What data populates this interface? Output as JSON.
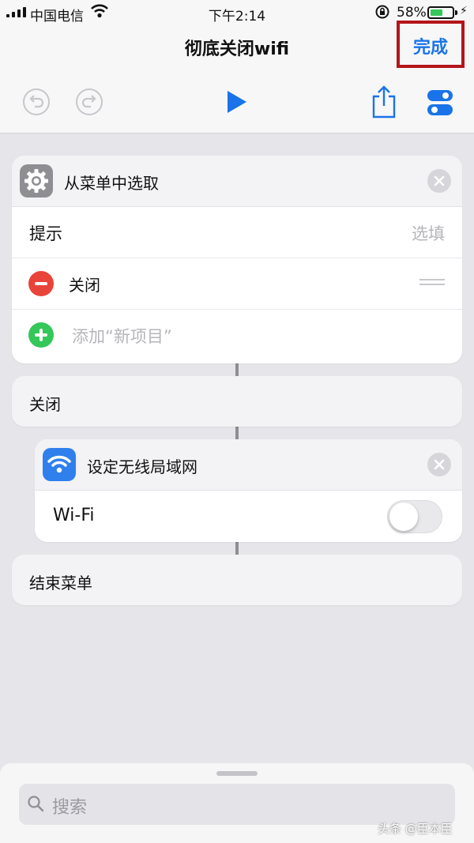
{
  "status_bar": {
    "carrier": "中国电信",
    "time": "下午2:14",
    "battery_percent": "58%",
    "battery_level": 0.58
  },
  "nav": {
    "title": "彻底关闭wifi",
    "done_label": "完成"
  },
  "toolbar": {
    "icons": [
      "undo-icon",
      "redo-icon",
      "play-icon",
      "share-icon",
      "settings-toggle-icon"
    ]
  },
  "choose_menu": {
    "title": "从菜单中选取",
    "prompt_label": "提示",
    "prompt_placeholder": "选填",
    "items": [
      {
        "label": "关闭"
      }
    ],
    "add_label": "添加“新项目”"
  },
  "menu_case": {
    "label": "关闭"
  },
  "set_wifi": {
    "title": "设定无线局域网",
    "wifi_label": "Wi-Fi",
    "wifi_on": false
  },
  "end_menu": {
    "label": "结束菜单"
  },
  "search": {
    "placeholder": "搜索"
  },
  "watermark": {
    "text": "头条 @臣本臣"
  },
  "colors": {
    "accent": "#1a73e8",
    "delete": "#e9443a",
    "add": "#34c759",
    "highlight_box": "#b4151b"
  }
}
